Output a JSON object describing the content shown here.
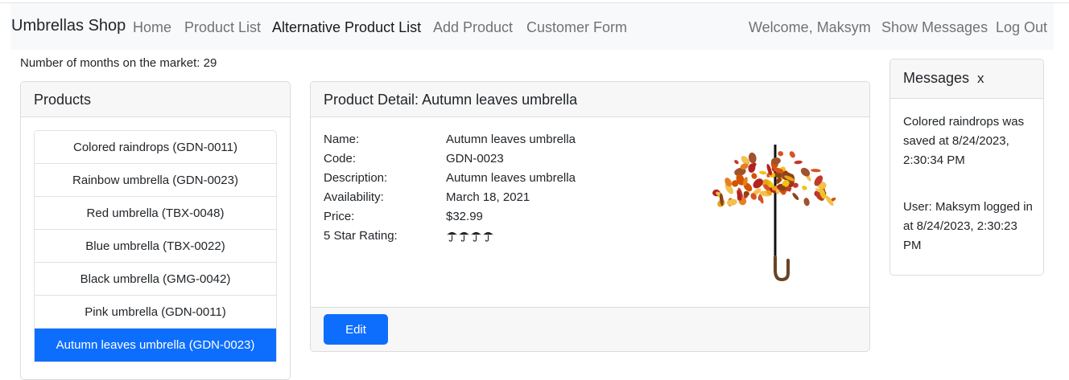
{
  "navbar": {
    "brand": "Umbrellas Shop",
    "links": [
      "Home",
      "Product List",
      "Alternative Product List",
      "Add Product",
      "Customer Form"
    ],
    "active_index": 2,
    "welcome": "Welcome, Maksym",
    "show_messages": "Show Messages",
    "logout": "Log Out"
  },
  "months_on_market": "Number of months on the market: 29",
  "products": {
    "title": "Products",
    "items": [
      "Colored raindrops (GDN-0011)",
      "Rainbow umbrella (GDN-0023)",
      "Red umbrella (TBX-0048)",
      "Blue umbrella (TBX-0022)",
      "Black umbrella (GMG-0042)",
      "Pink umbrella (GDN-0011)",
      "Autumn leaves umbrella (GDN-0023)"
    ],
    "selected_index": 6
  },
  "detail": {
    "title": "Product Detail: Autumn leaves umbrella",
    "fields": [
      {
        "label": "Name:",
        "value": "Autumn leaves umbrella"
      },
      {
        "label": "Code:",
        "value": "GDN-0023"
      },
      {
        "label": "Description:",
        "value": "Autumn leaves umbrella"
      },
      {
        "label": "Availability:",
        "value": "March 18, 2021"
      },
      {
        "label": "Price:",
        "value": "$32.99"
      }
    ],
    "rating_label": "5 Star Rating:",
    "rating": 4,
    "rating_icon": "umbrella-icon",
    "image_icon": "autumn-leaves-umbrella-image",
    "edit_label": "Edit"
  },
  "messages": {
    "title": "Messages",
    "close_label": "x",
    "items": [
      "Colored raindrops was saved at 8/24/2023, 2:30:34 PM",
      "User: Maksym logged in at 8/24/2023, 2:30:23 PM"
    ]
  },
  "colors": {
    "primary": "#0d6efd",
    "navbar_bg": "#f8f9fa",
    "card_header_bg": "#f7f7f7"
  }
}
